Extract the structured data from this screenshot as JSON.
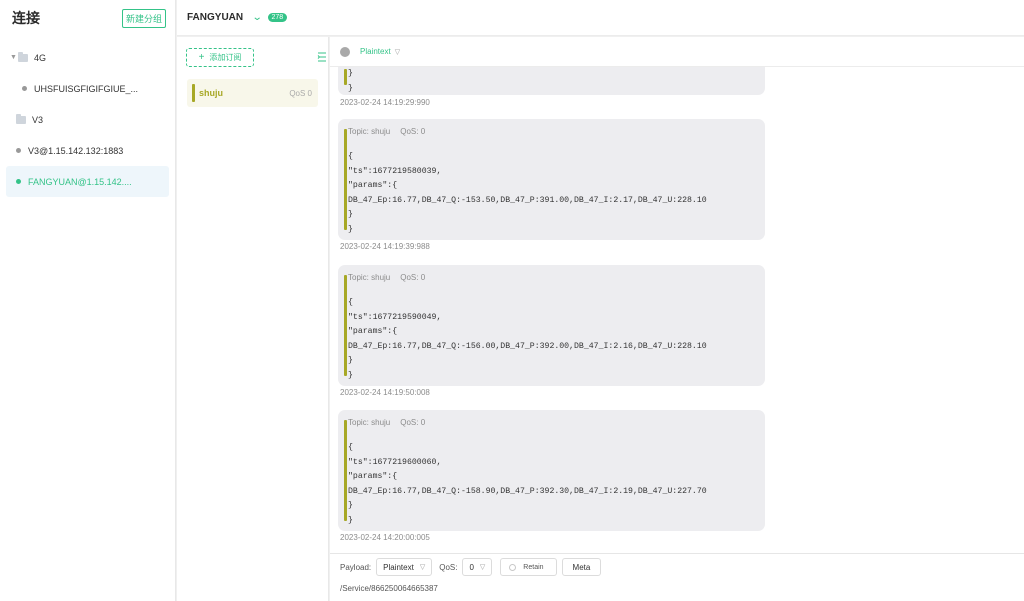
{
  "sidebar": {
    "title": "连接",
    "new_group_label": "新建分组",
    "items": [
      {
        "label": "4G",
        "type": "folder"
      },
      {
        "label": "UHSFUISGFIGIFGIUE_...",
        "type": "connection"
      },
      {
        "label": "V3",
        "type": "folder"
      },
      {
        "label": "V3@1.15.142.132:1883",
        "type": "connection"
      },
      {
        "label": "FANGYUAN@1.15.142....",
        "type": "connection",
        "active": true
      }
    ]
  },
  "topbar": {
    "connection_name": "FANGYUAN",
    "message_count": "278"
  },
  "subscriptions": {
    "add_label": "添加订阅",
    "items": [
      {
        "topic": "shuju",
        "qos": "QoS 0"
      }
    ]
  },
  "messages": {
    "format": "Plaintext",
    "partial_lines": "}\n}",
    "partial_time": "2023-02-24 14:19:29:990",
    "list": [
      {
        "topic": "Topic: shuju",
        "qos": "QoS: 0",
        "body": "{\n\"ts\":1677219580039,\n\"params\":{\nDB_47_Ep:16.77,DB_47_Q:-153.50,DB_47_P:391.00,DB_47_I:2.17,DB_47_U:228.10\n}\n}",
        "time": "2023-02-24 14:19:39:988"
      },
      {
        "topic": "Topic: shuju",
        "qos": "QoS: 0",
        "body": "{\n\"ts\":1677219590049,\n\"params\":{\nDB_47_Ep:16.77,DB_47_Q:-156.00,DB_47_P:392.00,DB_47_I:2.16,DB_47_U:228.10\n}\n}",
        "time": "2023-02-24 14:19:50:008"
      },
      {
        "topic": "Topic: shuju",
        "qos": "QoS: 0",
        "body": "{\n\"ts\":1677219600060,\n\"params\":{\nDB_47_Ep:16.77,DB_47_Q:-158.90,DB_47_P:392.30,DB_47_I:2.19,DB_47_U:227.70\n}\n}",
        "time": "2023-02-24 14:20:00:005"
      }
    ]
  },
  "publish": {
    "payload_label": "Payload:",
    "payload_format": "Plaintext",
    "qos_label": "QoS:",
    "qos_value": "0",
    "retain_label": "Retain",
    "meta_label": "Meta",
    "topic": "/Service/866250064665387"
  },
  "colors": {
    "accent": "#34c388",
    "topic_bar": "#a7a826"
  }
}
